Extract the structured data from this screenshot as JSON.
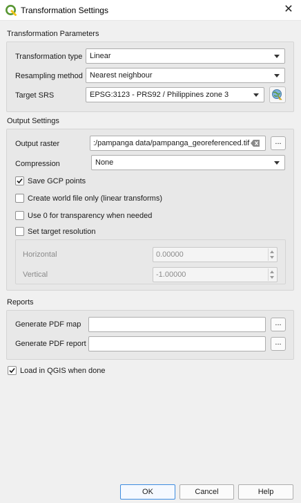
{
  "window": {
    "title": "Transformation Settings"
  },
  "transformation_parameters": {
    "heading": "Transformation Parameters",
    "transformation_type_label": "Transformation type",
    "transformation_type_value": "Linear",
    "resampling_label": "Resampling method",
    "resampling_value": "Nearest neighbour",
    "target_srs_label": "Target SRS",
    "target_srs_value": "EPSG:3123 - PRS92 / Philippines zone 3"
  },
  "output_settings": {
    "heading": "Output Settings",
    "output_raster_label": "Output raster",
    "output_raster_value": ":/pampanga data/pampanga_georeferenced.tif",
    "browse_label": "...",
    "compression_label": "Compression",
    "compression_value": "None",
    "save_gcp_label": "Save GCP points",
    "save_gcp_checked": true,
    "world_file_label": "Create world file only (linear transforms)",
    "world_file_checked": false,
    "use_zero_label": "Use 0 for transparency when needed",
    "use_zero_checked": false,
    "target_res_label": "Set target resolution",
    "target_res_checked": false,
    "horizontal_label": "Horizontal",
    "horizontal_value": "0.00000",
    "vertical_label": "Vertical",
    "vertical_value": "-1.00000"
  },
  "reports": {
    "heading": "Reports",
    "pdf_map_label": "Generate PDF map",
    "pdf_map_value": "",
    "pdf_report_label": "Generate PDF report",
    "pdf_report_value": "",
    "browse_label": "..."
  },
  "load_in_qgis": {
    "label": "Load in QGIS when done",
    "checked": true
  },
  "buttons": {
    "ok": "OK",
    "cancel": "Cancel",
    "help": "Help"
  },
  "colors": {
    "accent": "#3c8be0",
    "qgis_green": "#589632",
    "qgis_yellow": "#f0c419"
  }
}
